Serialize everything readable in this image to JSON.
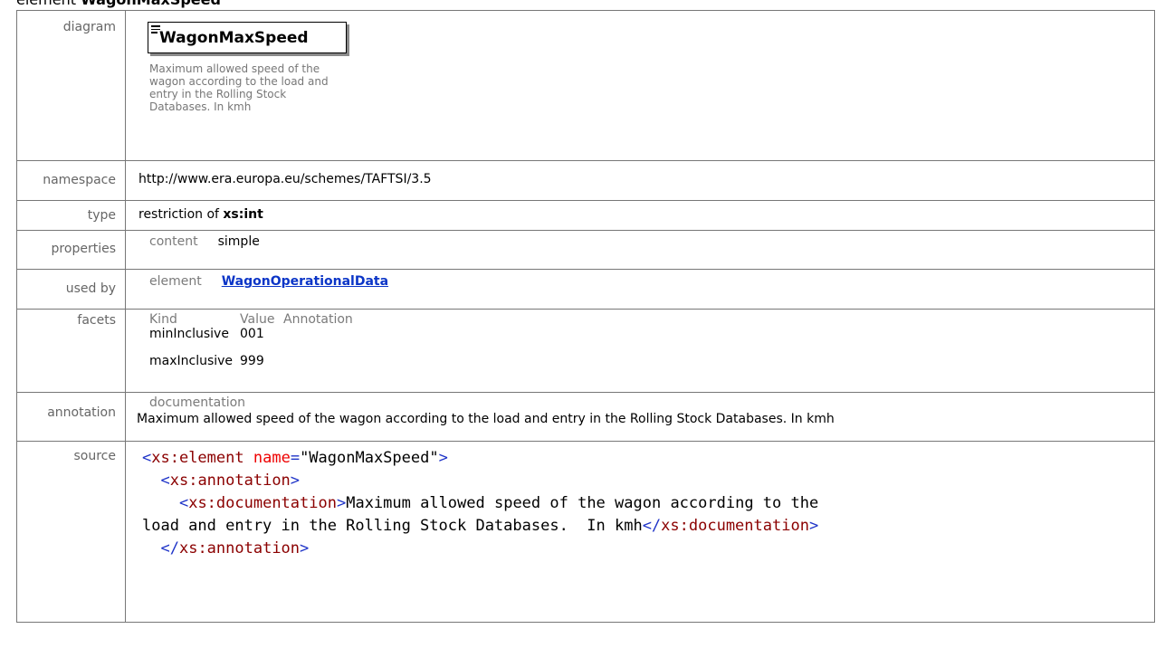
{
  "heading": {
    "prefix": "element",
    "name": "WagonMaxSpeed"
  },
  "rows": {
    "diagram": {
      "label": "diagram",
      "element_name": "WagonMaxSpeed",
      "doc": "Maximum allowed speed of the wagon according to the load and entry in the Rolling Stock Databases.  In kmh"
    },
    "namespace": {
      "label": "namespace",
      "value": "http://www.era.europa.eu/schemes/TAFTSI/3.5"
    },
    "type": {
      "label": "type",
      "prefix": "restriction of",
      "base": "xs:int"
    },
    "properties": {
      "label": "properties",
      "sub_label": "content",
      "value": "simple"
    },
    "used_by": {
      "label": "used by",
      "sub_label": "element",
      "link": "WagonOperationalData"
    },
    "facets": {
      "label": "facets",
      "headers": [
        "Kind",
        "Value",
        "Annotation"
      ],
      "items": [
        {
          "kind": "minInclusive",
          "value": "001",
          "annotation": ""
        },
        {
          "kind": "maxInclusive",
          "value": "999",
          "annotation": ""
        }
      ]
    },
    "annotation": {
      "label": "annotation",
      "sub_label": "documentation",
      "text": "Maximum allowed speed of the wagon according to the load and entry in the Rolling Stock Databases.  In kmh"
    },
    "source": {
      "label": "source",
      "code": {
        "l1_open": "<xs:element",
        "l1_attr": "name",
        "l1_eq": "=",
        "l1_val": "\"WagonMaxSpeed\"",
        "l1_close": ">",
        "l2": "<xs:annotation>",
        "l3_open": "<xs:documentation>",
        "l3_text": "Maximum allowed speed of the wagon according to the",
        "l4_text": "load and entry in the Rolling Stock Databases.  In kmh",
        "l4_close": "</xs:documentation>",
        "l5": "</xs:annotation>"
      }
    }
  }
}
